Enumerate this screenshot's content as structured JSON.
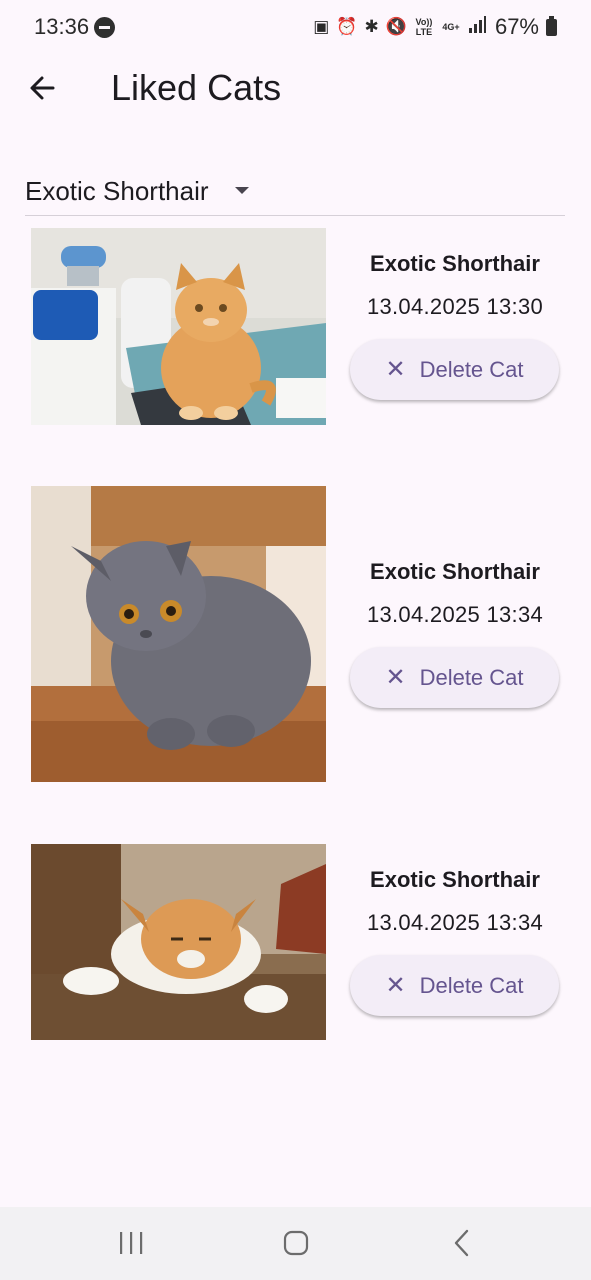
{
  "status_bar": {
    "time": "13:36",
    "volte_label": "Vo)) LTE",
    "network_label": "4G+",
    "battery_percent": "67%"
  },
  "app_bar": {
    "title": "Liked Cats",
    "back_icon": "arrow-left-icon"
  },
  "filter": {
    "selected_breed": "Exotic Shorthair"
  },
  "cats": [
    {
      "breed": "Exotic Shorthair",
      "liked_at": "13.04.2025 13:30",
      "delete_label": "Delete Cat"
    },
    {
      "breed": "Exotic Shorthair",
      "liked_at": "13.04.2025 13:34",
      "delete_label": "Delete Cat"
    },
    {
      "breed": "Exotic Shorthair",
      "liked_at": "13.04.2025 13:34",
      "delete_label": "Delete Cat"
    }
  ],
  "colors": {
    "background": "#fdf7fd",
    "accent": "#65558f",
    "button_bg": "#f3edf7",
    "text": "#1d1b20"
  }
}
